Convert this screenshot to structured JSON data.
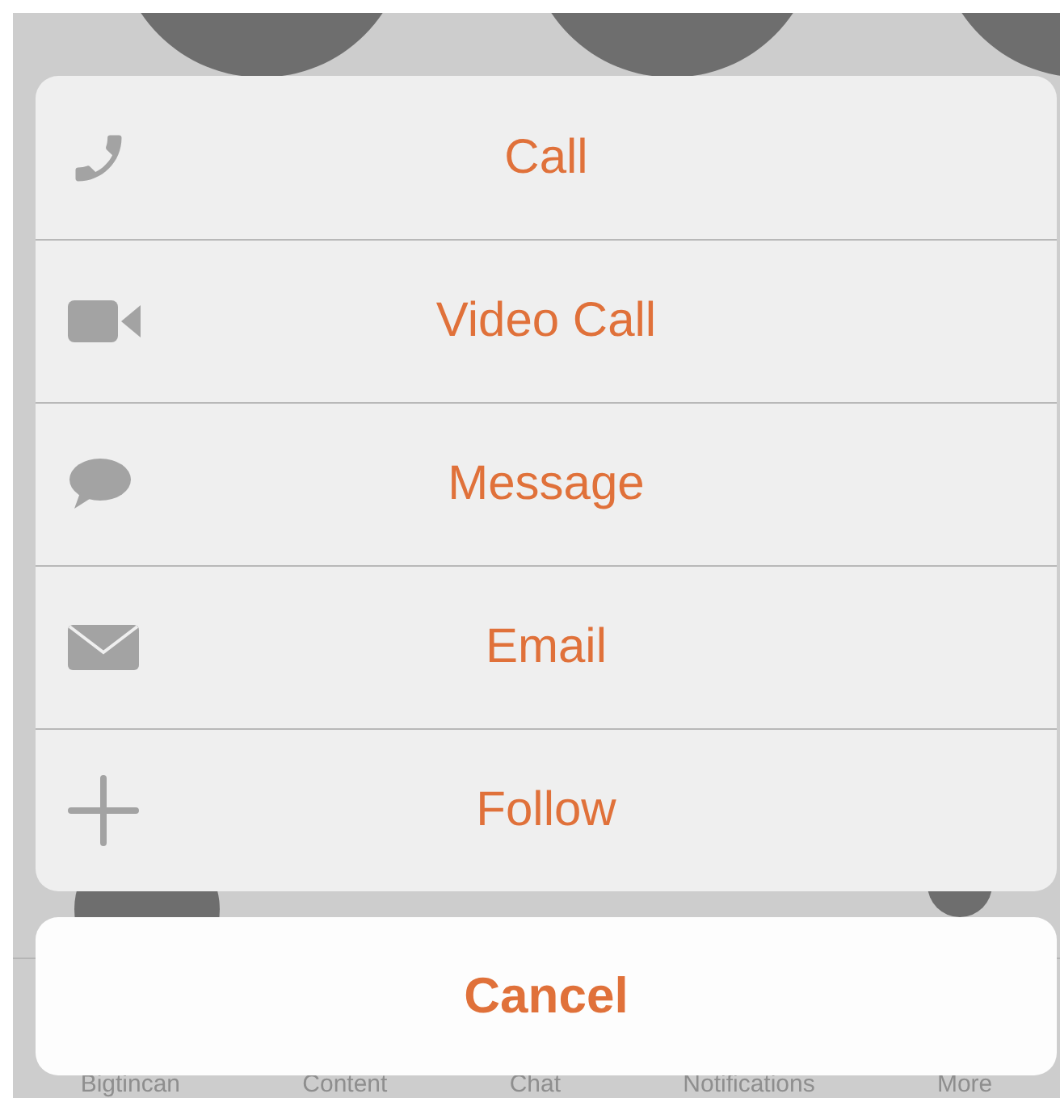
{
  "action_sheet": {
    "actions": [
      {
        "kind": "phone",
        "label": "Call"
      },
      {
        "kind": "video",
        "label": "Video Call"
      },
      {
        "kind": "message",
        "label": "Message"
      },
      {
        "kind": "email",
        "label": "Email"
      },
      {
        "kind": "follow",
        "label": "Follow"
      }
    ],
    "cancel": "Cancel"
  },
  "tab_bar": {
    "items": [
      "Bigtincan",
      "Content",
      "Chat",
      "Notifications",
      "More"
    ]
  }
}
